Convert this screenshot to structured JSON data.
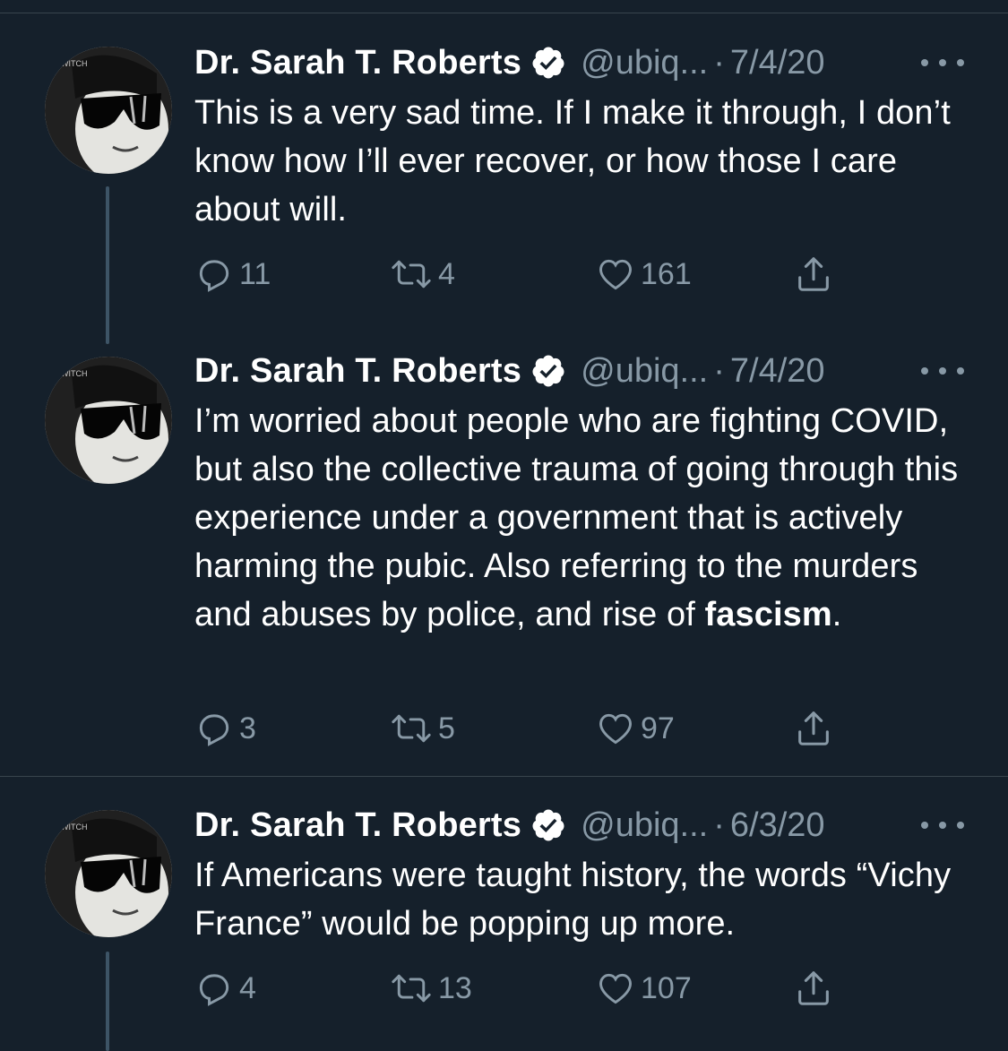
{
  "colors": {
    "background": "#15202b",
    "text_primary": "#ffffff",
    "text_secondary": "#8899a6",
    "divider": "#38444d",
    "thread_line": "#3d5466"
  },
  "tweets": [
    {
      "author_name": "Dr. Sarah T. Roberts",
      "verified": true,
      "handle": "@ubiq...",
      "separator": "·",
      "date": "7/4/20",
      "text": "This is a very sad time. If I make it through, I don’t know how I’ll ever recover, or how those I care about will.",
      "text_bold": "",
      "text_end": "",
      "replies": "11",
      "retweets": "4",
      "likes": "161",
      "avatar_icon": "avatar-sunglasses-portrait"
    },
    {
      "author_name": "Dr. Sarah T. Roberts",
      "verified": true,
      "handle": "@ubiq...",
      "separator": "·",
      "date": "7/4/20",
      "text": "I’m worried about people who are fighting COVID, but also the collective trauma of going through this experience under a government that is actively harming the pubic. Also referring to the murders and abuses by police, and rise of ",
      "text_bold": "fascism",
      "text_end": ".",
      "replies": "3",
      "retweets": "5",
      "likes": "97",
      "avatar_icon": "avatar-sunglasses-portrait"
    },
    {
      "author_name": "Dr. Sarah T. Roberts",
      "verified": true,
      "handle": "@ubiq...",
      "separator": "·",
      "date": "6/3/20",
      "text": "If Americans were taught history, the words “Vichy France” would be popping up more.",
      "text_bold": "",
      "text_end": "",
      "replies": "4",
      "retweets": "13",
      "likes": "107",
      "avatar_icon": "avatar-sunglasses-portrait"
    }
  ],
  "avatar_caption": "A WITCH"
}
